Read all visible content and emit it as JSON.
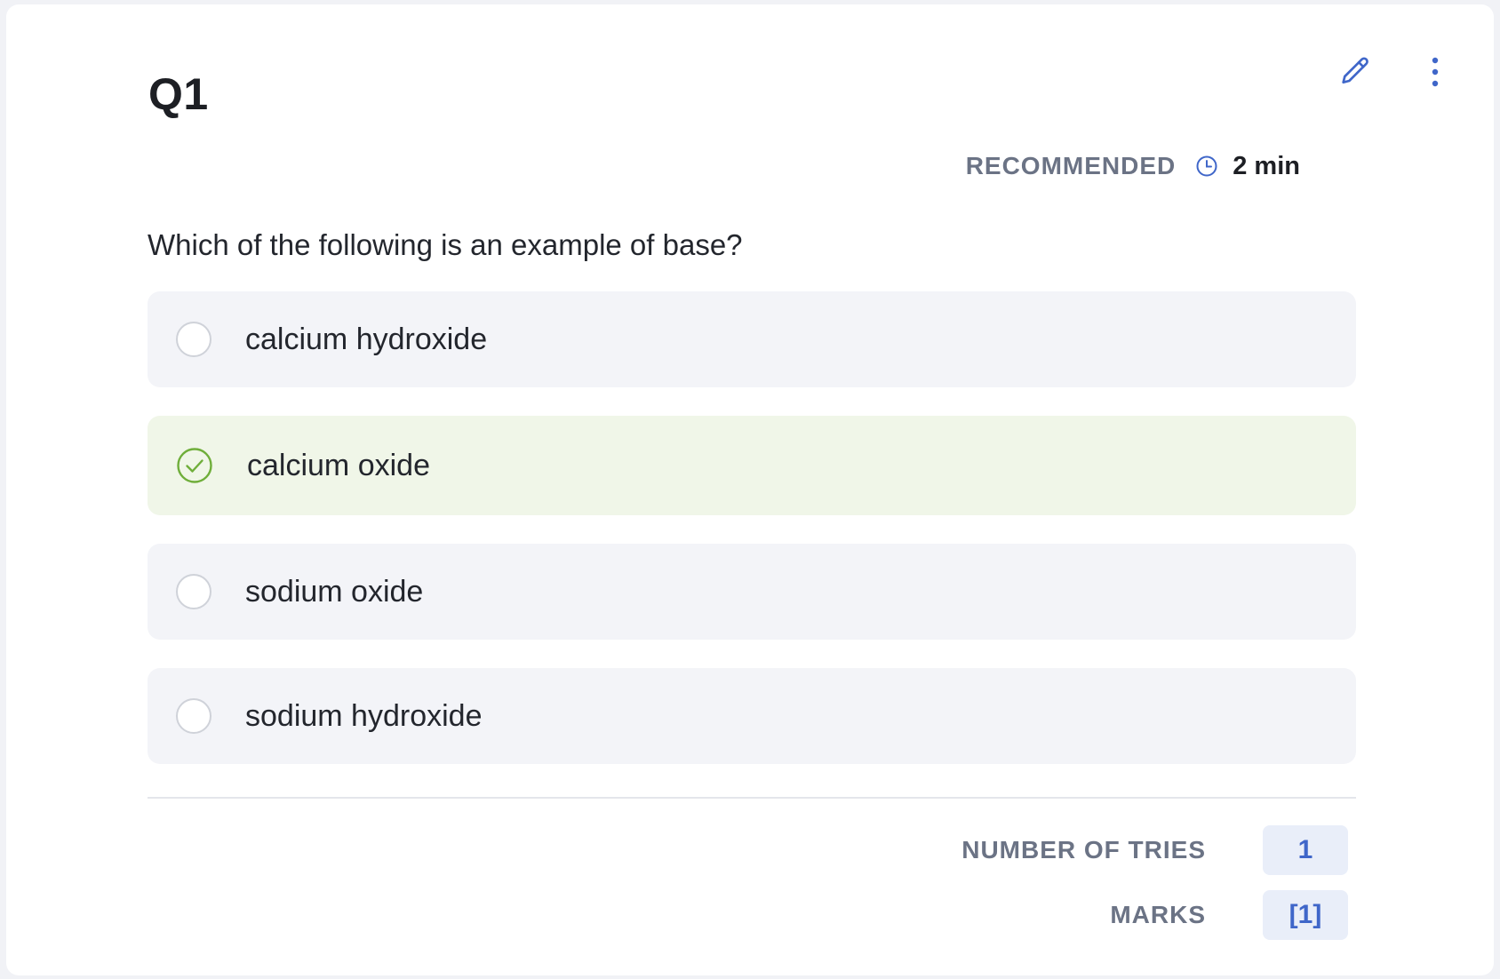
{
  "question": {
    "number": "Q1",
    "recommended_label": "RECOMMENDED",
    "recommended_time": "2 min",
    "text": "Which of the following is an example of base?",
    "options": [
      {
        "label": "calcium hydroxide",
        "state": "unselected"
      },
      {
        "label": "calcium oxide",
        "state": "correct"
      },
      {
        "label": "sodium oxide",
        "state": "unselected"
      },
      {
        "label": "sodium hydroxide",
        "state": "unselected"
      }
    ]
  },
  "footer": {
    "tries_label": "NUMBER OF TRIES",
    "tries_value": "1",
    "marks_label": "MARKS",
    "marks_value": "[1]"
  },
  "icons": {
    "edit": "pencil-icon",
    "more": "more-vertical-icon",
    "clock": "clock-icon",
    "check": "check-circle-icon"
  },
  "colors": {
    "accent": "#3f66c9",
    "correct_green": "#6fae3a",
    "correct_bg": "#f0f6e8",
    "option_bg": "#f3f4f8",
    "muted_text": "#6b7385"
  }
}
